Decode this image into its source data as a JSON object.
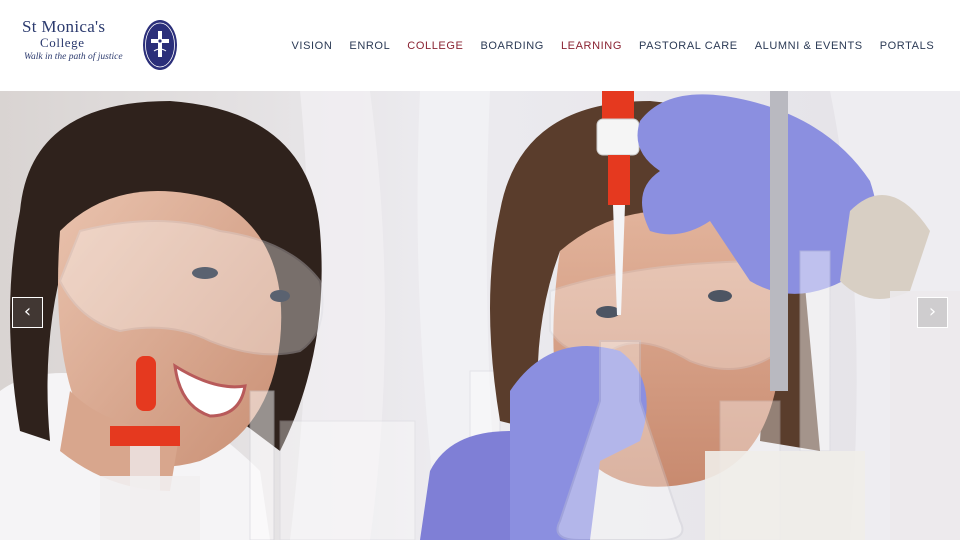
{
  "logo": {
    "name": "St Monica's",
    "sub": "College",
    "tagline": "Walk in the path of justice"
  },
  "nav": [
    {
      "label": "VISION",
      "active": false
    },
    {
      "label": "ENROL",
      "active": false
    },
    {
      "label": "COLLEGE",
      "active": true
    },
    {
      "label": "BOARDING",
      "active": false
    },
    {
      "label": "LEARNING",
      "active": true
    },
    {
      "label": "PASTORAL CARE",
      "active": false
    },
    {
      "label": "ALUMNI & EVENTS",
      "active": false
    },
    {
      "label": "PORTALS",
      "active": false
    }
  ],
  "carousel": {
    "prev_glyph": "‹",
    "next_glyph": "›"
  },
  "colors": {
    "brand_navy": "#2b3a6e",
    "nav_text": "#2b3a55",
    "nav_active": "#8a2332",
    "pipette_red": "#e5391f",
    "glove_purple": "#8b8fe0"
  }
}
